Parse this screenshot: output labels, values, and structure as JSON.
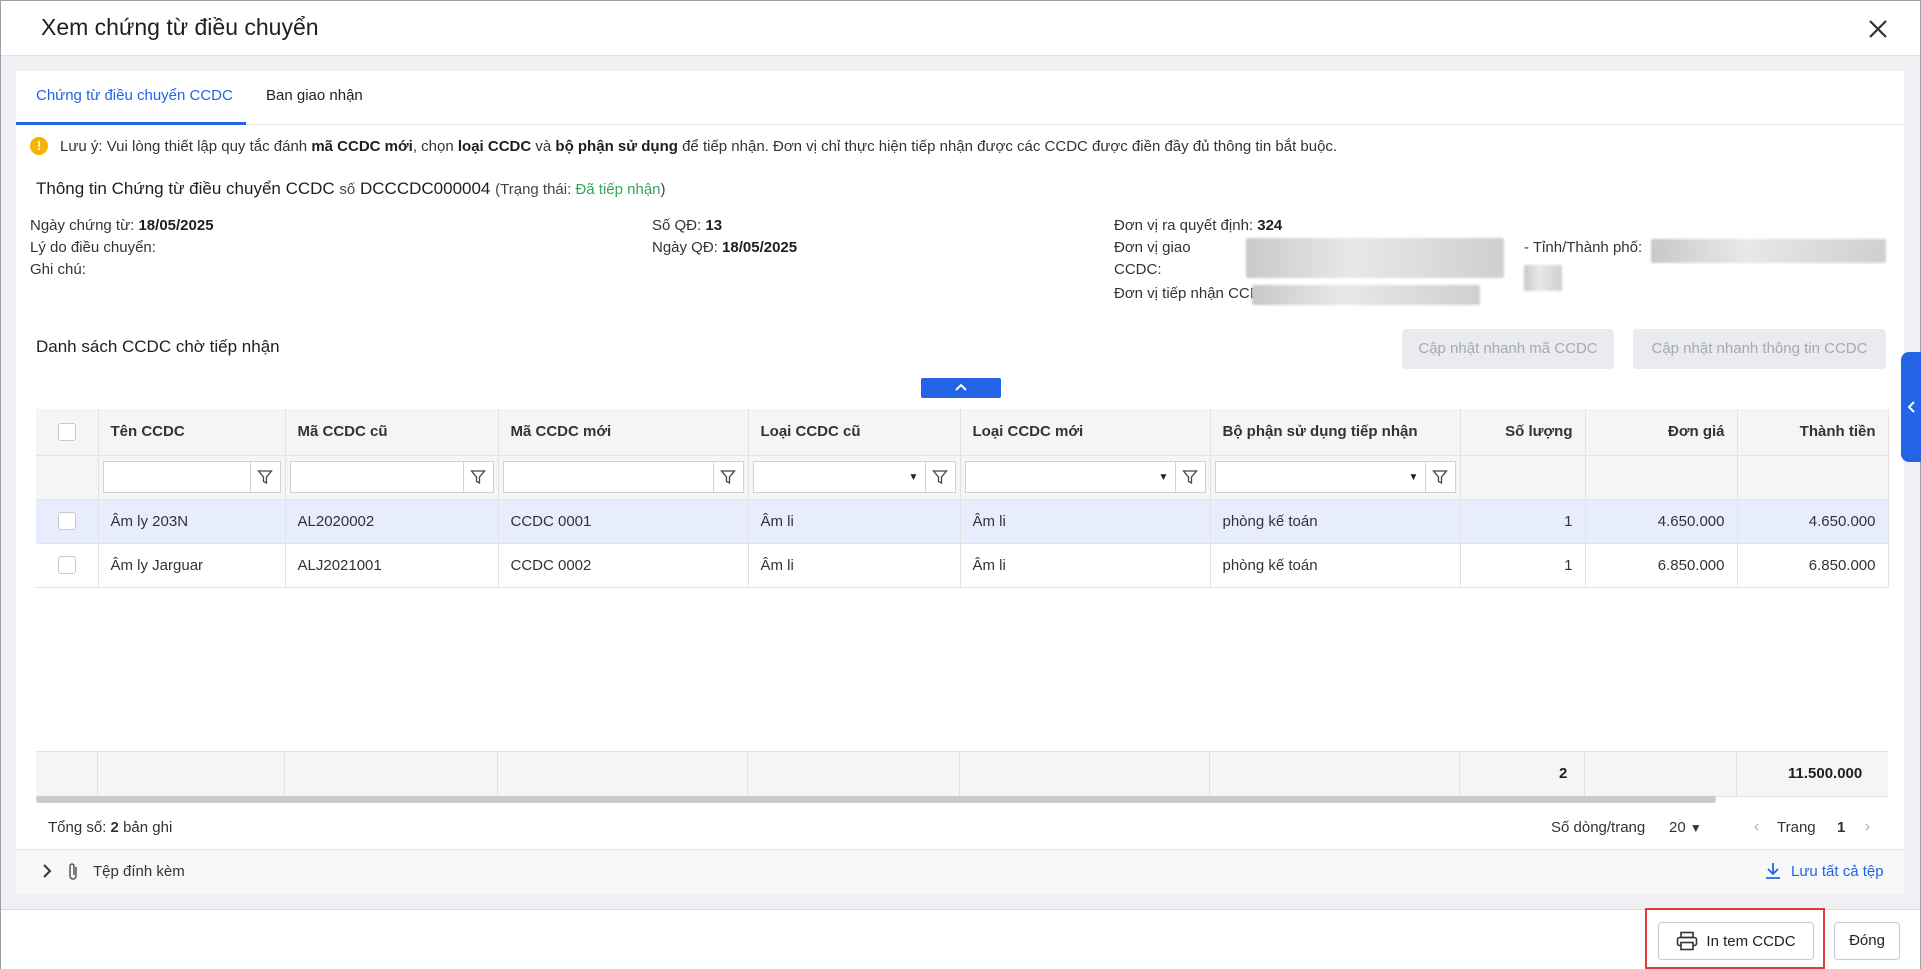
{
  "dialog": {
    "title": "Xem chứng từ điều chuyển"
  },
  "tabs": [
    {
      "label": "Chứng từ điều chuyển CCDC"
    },
    {
      "label": "Ban giao nhận"
    }
  ],
  "notice": {
    "p1": "Lưu ý: Vui lòng thiết lập quy tắc đánh ",
    "b1": "mã CCDC mới",
    "p2": ", chọn ",
    "b2": "loại CCDC",
    "p3": " và ",
    "b3": "bộ phận sử dụng",
    "p4": " để tiếp nhận. Đơn vị chỉ thực hiện tiếp nhận được các CCDC được điền đầy đủ thông tin bắt buộc."
  },
  "section": {
    "title": "Thông tin Chứng từ điều chuyển CCDC",
    "so_label": "số",
    "doc_no": "DCCCDC000004",
    "status_prefix": "(Trạng thái: ",
    "status": "Đã tiếp nhận",
    "status_suffix": ")"
  },
  "info": {
    "ngay_ct_label": "Ngày chứng từ:",
    "ngay_ct": "18/05/2025",
    "ly_do_label": "Lý do điều chuyển:",
    "ghi_chu_label": "Ghi chú:",
    "so_qd_label": "Số QĐ:",
    "so_qd": "13",
    "ngay_qd_label": "Ngày QĐ:",
    "ngay_qd": "18/05/2025",
    "dv_ra_qd_label": "Đơn vị ra quyết định:",
    "dv_ra_qd": "324",
    "dv_giao_label": "Đơn vị giao",
    "ccdc_label": "CCDC:",
    "tinh_label": "- Tỉnh/Thành phố:",
    "dv_tiep_nhan_label": "Đơn vị tiếp nhận CCDC:"
  },
  "list": {
    "title": "Danh sách CCDC chờ tiếp nhận",
    "btn_update_code": "Cập nhật nhanh mã CCDC",
    "btn_update_info": "Cập nhật nhanh thông tin CCDC"
  },
  "table": {
    "columns": [
      "Tên CCDC",
      "Mã CCDC cũ",
      "Mã CCDC mới",
      "Loại CCDC cũ",
      "Loại CCDC mới",
      "Bộ phận sử dụng tiếp nhận",
      "Số lượng",
      "Đơn giá",
      "Thành tiền"
    ],
    "rows": [
      [
        "Âm ly 203N",
        "AL2020002",
        "CCDC 0001",
        "Âm li",
        "Âm li",
        "phòng kế toán",
        "1",
        "4.650.000",
        "4.650.000"
      ],
      [
        "Âm ly Jarguar",
        "ALJ2021001",
        "CCDC 0002",
        "Âm li",
        "Âm li",
        "phòng kế toán",
        "1",
        "6.850.000",
        "6.850.000"
      ]
    ],
    "total_quantity": "2",
    "total_amount": "11.500.000"
  },
  "pager": {
    "total_label": "Tổng số:",
    "total_value": "2",
    "total_unit": "bản ghi",
    "rows_per_page_label": "Số dòng/trang",
    "rows_per_page": "20",
    "page_label": "Trang",
    "page": "1"
  },
  "attachments": {
    "label": "Tệp đính kèm",
    "save_all": "Lưu tất cả tệp"
  },
  "footer": {
    "print_label": "In tem CCDC",
    "close_label": "Đóng"
  },
  "colors": {
    "accent": "#2264e5",
    "status_green": "#33a853",
    "highlight_red": "#e03c3c"
  }
}
